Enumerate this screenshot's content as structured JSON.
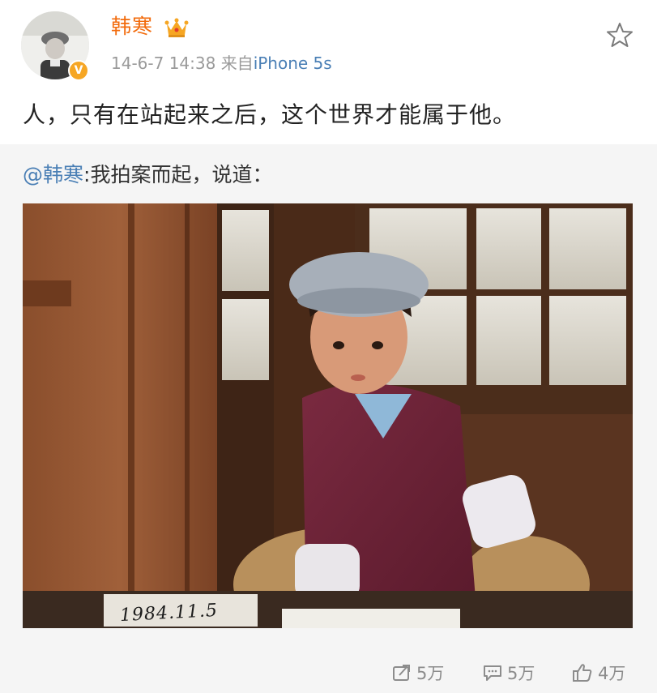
{
  "post": {
    "user_name": "韩寒",
    "time": "14-6-7 14:38",
    "source_prefix": "来自",
    "source": "iPhone 5s",
    "text": "人，只有在站起来之后，这个世界才能属于他。",
    "verified_badge": "V"
  },
  "repost": {
    "mention": "@韩寒",
    "text": ":我拍案而起，说道：",
    "photo_stamp": "1984.11.5"
  },
  "actions": {
    "repost_count": "5万",
    "comment_count": "5万",
    "like_count": "4万"
  },
  "icons": {
    "favorite": "star-outline-icon",
    "crown": "crown-icon",
    "repost": "repost-icon",
    "comment": "comment-icon",
    "like": "thumbs-up-icon"
  },
  "colors": {
    "username": "#f26b0c",
    "link": "#4a7fb5",
    "meta": "#9a9a9a",
    "repost_bg": "#f5f5f5",
    "verified": "#f6a623"
  }
}
